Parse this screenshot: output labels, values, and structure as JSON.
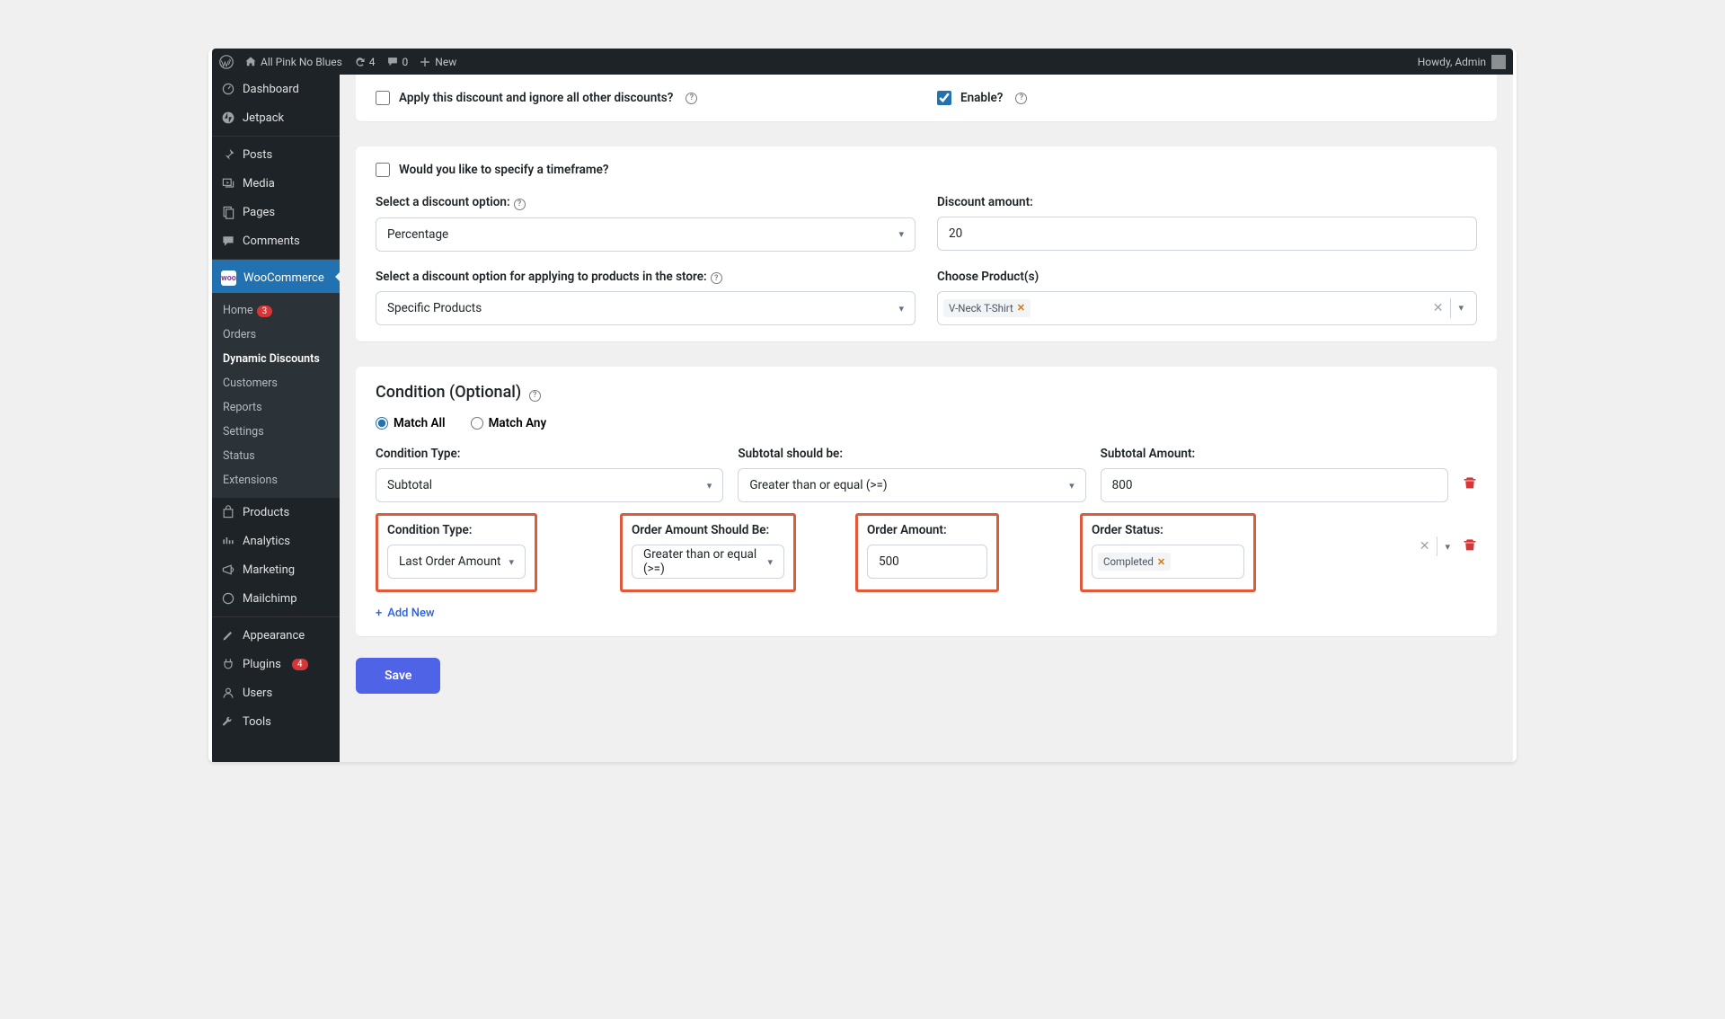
{
  "adminbar": {
    "site_name": "All Pink No Blues",
    "updates_count": "4",
    "comments_count": "0",
    "new_label": "New",
    "howdy": "Howdy, Admin"
  },
  "sidebar": {
    "dashboard": "Dashboard",
    "jetpack": "Jetpack",
    "posts": "Posts",
    "media": "Media",
    "pages": "Pages",
    "comments": "Comments",
    "woocommerce": "WooCommerce",
    "woo_sub": {
      "home": "Home",
      "home_badge": "3",
      "orders": "Orders",
      "dynamic": "Dynamic Discounts",
      "customers": "Customers",
      "reports": "Reports",
      "settings": "Settings",
      "status": "Status",
      "extensions": "Extensions"
    },
    "products": "Products",
    "analytics": "Analytics",
    "marketing": "Marketing",
    "mailchimp": "Mailchimp",
    "appearance": "Appearance",
    "plugins": "Plugins",
    "plugins_badge": "4",
    "users": "Users",
    "tools": "Tools"
  },
  "panel1": {
    "apply_ignore": "Apply this discount and ignore all other discounts?",
    "enable": "Enable?"
  },
  "panel2": {
    "timeframe": "Would you like to specify a timeframe?",
    "discount_option_label": "Select a discount option:",
    "discount_option_value": "Percentage",
    "discount_amount_label": "Discount amount:",
    "discount_amount_value": "20",
    "apply_products_label": "Select a discount option for applying to products in the store:",
    "apply_products_value": "Specific Products",
    "choose_products_label": "Choose Product(s)",
    "product_tag": "V-Neck T-Shirt"
  },
  "panel3": {
    "title": "Condition (Optional)",
    "match_all": "Match All",
    "match_any": "Match Any",
    "row1": {
      "type_label": "Condition Type:",
      "type_value": "Subtotal",
      "op_label": "Subtotal should be:",
      "op_value": "Greater than or equal (>=)",
      "amt_label": "Subtotal Amount:",
      "amt_value": "800"
    },
    "row2": {
      "type_label": "Condition Type:",
      "type_value": "Last Order Amount",
      "op_label": "Order Amount Should Be:",
      "op_value": "Greater than or equal (>=)",
      "amt_label": "Order Amount:",
      "amt_value": "500",
      "status_label": "Order Status:",
      "status_tag": "Completed"
    },
    "add_new": "Add New"
  },
  "save": "Save"
}
